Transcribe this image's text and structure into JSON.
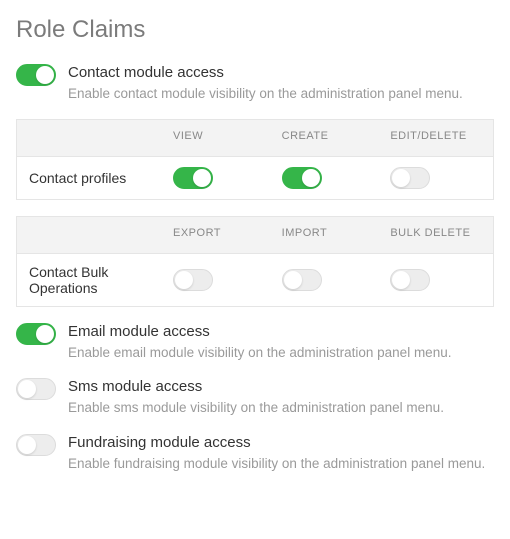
{
  "title": "Role Claims",
  "modules": {
    "contact": {
      "title": "Contact module access",
      "desc": "Enable contact module visibility on the administration panel menu.",
      "enabled": true
    },
    "email": {
      "title": "Email module access",
      "desc": "Enable email module visibility on the administration panel menu.",
      "enabled": true
    },
    "sms": {
      "title": "Sms module access",
      "desc": "Enable sms module visibility on the administration panel menu.",
      "enabled": false
    },
    "fundraising": {
      "title": "Fundraising module access",
      "desc": "Enable fundraising module visibility on the administration panel menu.",
      "enabled": false
    }
  },
  "tables": {
    "profiles": {
      "row_label": "Contact profiles",
      "columns": [
        "VIEW",
        "CREATE",
        "EDIT/DELETE"
      ],
      "values": [
        true,
        true,
        false
      ]
    },
    "bulk": {
      "row_label": "Contact Bulk Operations",
      "columns": [
        "EXPORT",
        "IMPORT",
        "BULK DELETE"
      ],
      "values": [
        false,
        false,
        false
      ]
    }
  }
}
